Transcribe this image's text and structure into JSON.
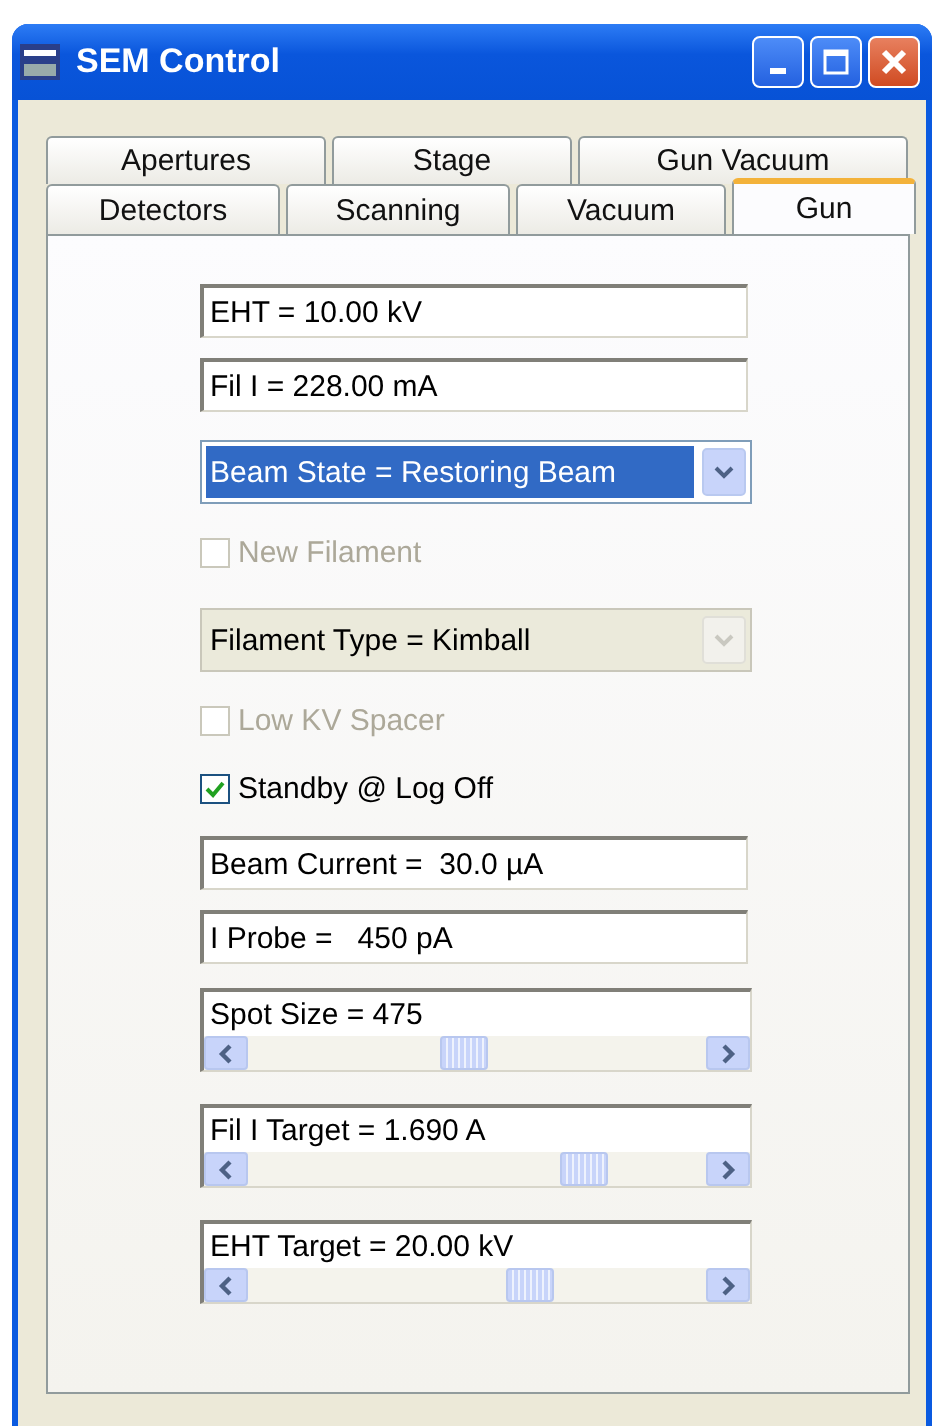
{
  "window": {
    "title": "SEM Control"
  },
  "tab_rows": [
    [
      {
        "label": "Apertures",
        "selected": false
      },
      {
        "label": "Stage",
        "selected": false
      },
      {
        "label": "Gun Vacuum",
        "selected": false
      }
    ],
    [
      {
        "label": "Detectors",
        "selected": false
      },
      {
        "label": "Scanning",
        "selected": false
      },
      {
        "label": "Vacuum",
        "selected": false
      },
      {
        "label": "Gun",
        "selected": true
      }
    ]
  ],
  "controls": [
    {
      "kind": "field",
      "value": "EHT = 10.00 kV"
    },
    {
      "kind": "field",
      "value": "Fil I = 228.00 mA"
    },
    {
      "kind": "dropdown",
      "value": "Beam State = Restoring Beam",
      "selected": true,
      "disabled": false
    },
    {
      "kind": "checkbox",
      "label": "New Filament",
      "checked": false,
      "disabled": true
    },
    {
      "kind": "dropdown",
      "value": "Filament Type = Kimball",
      "selected": false,
      "disabled": true
    },
    {
      "kind": "checkbox",
      "label": "Low KV Spacer",
      "checked": false,
      "disabled": true
    },
    {
      "kind": "checkbox",
      "label": "Standby @ Log Off",
      "checked": true,
      "disabled": false
    },
    {
      "kind": "field",
      "value": "Beam Current =  30.0 µA"
    },
    {
      "kind": "field",
      "value": "I Probe =   450 pA"
    },
    {
      "kind": "slider",
      "value": "Spot Size = 475"
    },
    {
      "kind": "slider",
      "value": "Fil I Target =  1.690 A"
    },
    {
      "kind": "slider",
      "value": "EHT Target = 20.00 kV"
    }
  ]
}
